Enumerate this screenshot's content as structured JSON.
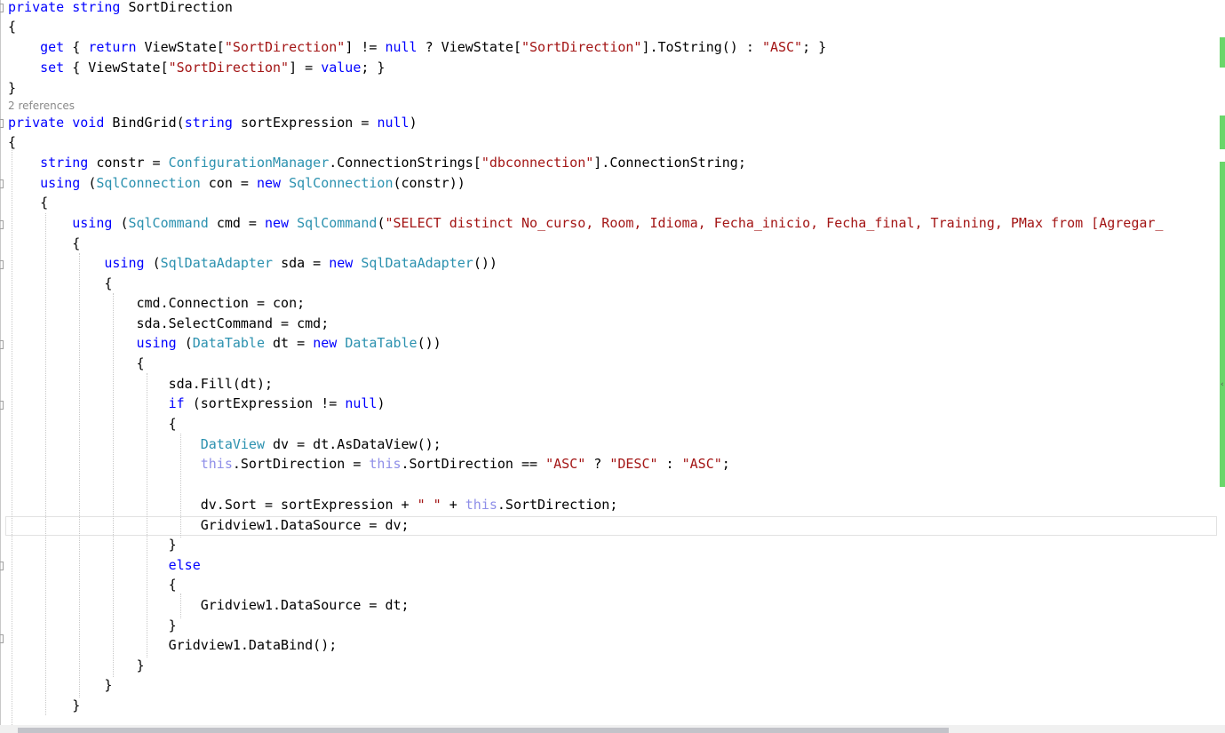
{
  "editor": {
    "codelens": "2 references",
    "lines": [
      [
        [
          "kw",
          "private "
        ],
        [
          "kw",
          "string "
        ],
        [
          "pl",
          "SortDirection"
        ]
      ],
      [
        [
          "pl",
          "{"
        ]
      ],
      [
        [
          "pl",
          "    "
        ],
        [
          "kw",
          "get "
        ],
        [
          "pl",
          "{ "
        ],
        [
          "kw",
          "return "
        ],
        [
          "pl",
          "ViewState["
        ],
        [
          "str",
          "\"SortDirection\""
        ],
        [
          "pl",
          "] != "
        ],
        [
          "kw",
          "null "
        ],
        [
          "pl",
          "? ViewState["
        ],
        [
          "str",
          "\"SortDirection\""
        ],
        [
          "pl",
          "].ToString() : "
        ],
        [
          "str",
          "\"ASC\""
        ],
        [
          "pl",
          "; }"
        ]
      ],
      [
        [
          "pl",
          "    "
        ],
        [
          "kw",
          "set "
        ],
        [
          "pl",
          "{ ViewState["
        ],
        [
          "str",
          "\"SortDirection\""
        ],
        [
          "pl",
          "] = "
        ],
        [
          "kw",
          "value"
        ],
        [
          "pl",
          "; }"
        ]
      ],
      [
        [
          "pl",
          "}"
        ]
      ],
      [
        [
          "kw",
          "private "
        ],
        [
          "kw",
          "void "
        ],
        [
          "pl",
          "BindGrid("
        ],
        [
          "kw",
          "string "
        ],
        [
          "pl",
          "sortExpression = "
        ],
        [
          "kw",
          "null"
        ],
        [
          "pl",
          ")"
        ]
      ],
      [
        [
          "pl",
          "{"
        ]
      ],
      [
        [
          "pl",
          "    "
        ],
        [
          "kw",
          "string "
        ],
        [
          "pl",
          "constr = "
        ],
        [
          "ty",
          "ConfigurationManager"
        ],
        [
          "pl",
          ".ConnectionStrings["
        ],
        [
          "str",
          "\"dbconnection\""
        ],
        [
          "pl",
          "].ConnectionString;"
        ]
      ],
      [
        [
          "pl",
          "    "
        ],
        [
          "kw",
          "using "
        ],
        [
          "pl",
          "("
        ],
        [
          "ty",
          "SqlConnection "
        ],
        [
          "pl",
          "con = "
        ],
        [
          "kw",
          "new "
        ],
        [
          "ty",
          "SqlConnection"
        ],
        [
          "pl",
          "(constr))"
        ]
      ],
      [
        [
          "pl",
          "    {"
        ]
      ],
      [
        [
          "pl",
          "        "
        ],
        [
          "kw",
          "using "
        ],
        [
          "pl",
          "("
        ],
        [
          "ty",
          "SqlCommand "
        ],
        [
          "pl",
          "cmd = "
        ],
        [
          "kw",
          "new "
        ],
        [
          "ty",
          "SqlCommand"
        ],
        [
          "pl",
          "("
        ],
        [
          "str",
          "\"SELECT distinct No_curso, Room, Idioma, Fecha_inicio, Fecha_final, Training, PMax from [Agregar_"
        ]
      ],
      [
        [
          "pl",
          "        {"
        ]
      ],
      [
        [
          "pl",
          "            "
        ],
        [
          "kw",
          "using "
        ],
        [
          "pl",
          "("
        ],
        [
          "ty",
          "SqlDataAdapter "
        ],
        [
          "pl",
          "sda = "
        ],
        [
          "kw",
          "new "
        ],
        [
          "ty",
          "SqlDataAdapter"
        ],
        [
          "pl",
          "())"
        ]
      ],
      [
        [
          "pl",
          "            {"
        ]
      ],
      [
        [
          "pl",
          "                cmd.Connection = con;"
        ]
      ],
      [
        [
          "pl",
          "                sda.SelectCommand = cmd;"
        ]
      ],
      [
        [
          "pl",
          "                "
        ],
        [
          "kw",
          "using "
        ],
        [
          "pl",
          "("
        ],
        [
          "ty",
          "DataTable "
        ],
        [
          "pl",
          "dt = "
        ],
        [
          "kw",
          "new "
        ],
        [
          "ty",
          "DataTable"
        ],
        [
          "pl",
          "())"
        ]
      ],
      [
        [
          "pl",
          "                {"
        ]
      ],
      [
        [
          "pl",
          "                    sda.Fill(dt);"
        ]
      ],
      [
        [
          "pl",
          "                    "
        ],
        [
          "kw",
          "if "
        ],
        [
          "pl",
          "(sortExpression != "
        ],
        [
          "kw",
          "null"
        ],
        [
          "pl",
          ")"
        ]
      ],
      [
        [
          "pl",
          "                    {"
        ]
      ],
      [
        [
          "pl",
          "                        "
        ],
        [
          "ty",
          "DataView "
        ],
        [
          "pl",
          "dv = dt.AsDataView();"
        ]
      ],
      [
        [
          "pl",
          "                        "
        ],
        [
          "th",
          "this"
        ],
        [
          "pl",
          ".SortDirection = "
        ],
        [
          "th",
          "this"
        ],
        [
          "pl",
          ".SortDirection == "
        ],
        [
          "str",
          "\"ASC\""
        ],
        [
          "pl",
          " ? "
        ],
        [
          "str",
          "\"DESC\""
        ],
        [
          "pl",
          " : "
        ],
        [
          "str",
          "\"ASC\""
        ],
        [
          "pl",
          ";"
        ]
      ],
      [],
      [
        [
          "pl",
          "                        dv.Sort = sortExpression + "
        ],
        [
          "str",
          "\" \""
        ],
        [
          "pl",
          " + "
        ],
        [
          "th",
          "this"
        ],
        [
          "pl",
          ".SortDirection;"
        ]
      ],
      [
        [
          "pl",
          "                        Gridview1.DataSource = dv;"
        ]
      ],
      [
        [
          "pl",
          "                    }"
        ]
      ],
      [
        [
          "pl",
          "                    "
        ],
        [
          "kw",
          "else"
        ]
      ],
      [
        [
          "pl",
          "                    {"
        ]
      ],
      [
        [
          "pl",
          "                        Gridview1.DataSource = dt;"
        ]
      ],
      [
        [
          "pl",
          "                    }"
        ]
      ],
      [
        [
          "pl",
          "                    Gridview1.DataBind();"
        ]
      ],
      [
        [
          "pl",
          "                }"
        ]
      ],
      [
        [
          "pl",
          "            }"
        ]
      ],
      [
        [
          "pl",
          "        }"
        ]
      ]
    ]
  },
  "colors": {
    "keyword": "#0000ff",
    "type": "#2b91af",
    "string": "#a31515",
    "this_keyword": "#8f8fe8",
    "codelens": "#8a8a8a",
    "change_bar": "#6ad66a"
  }
}
